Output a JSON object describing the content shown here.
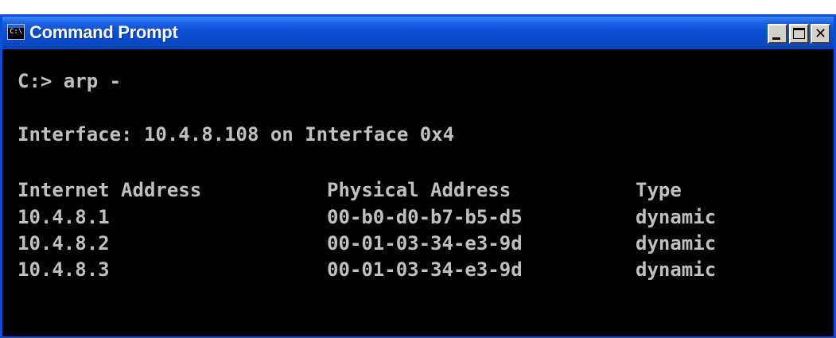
{
  "window": {
    "title": "Command Prompt",
    "icon": "C:\\",
    "controls": {
      "minimize_icon": "minimize-icon",
      "maximize_icon": "maximize-icon",
      "close_icon": "close-icon",
      "close_glyph": "✕"
    }
  },
  "console": {
    "prompt_line": "C:> arp -",
    "interface_line": "Interface: 10.4.8.108 on Interface 0x4",
    "table": {
      "headers": [
        "Internet Address",
        "Physical Address",
        "Type"
      ],
      "rows": [
        [
          "10.4.8.1",
          "00-b0-d0-b7-b5-d5",
          "dynamic"
        ],
        [
          "10.4.8.2",
          "00-01-03-34-e3-9d",
          "dynamic"
        ],
        [
          "10.4.8.3",
          "00-01-03-34-e3-9d",
          "dynamic"
        ]
      ]
    }
  },
  "colors": {
    "title_bar": "#0a4fd6",
    "console_background": "#000000",
    "console_text": "#c0c0c0"
  }
}
